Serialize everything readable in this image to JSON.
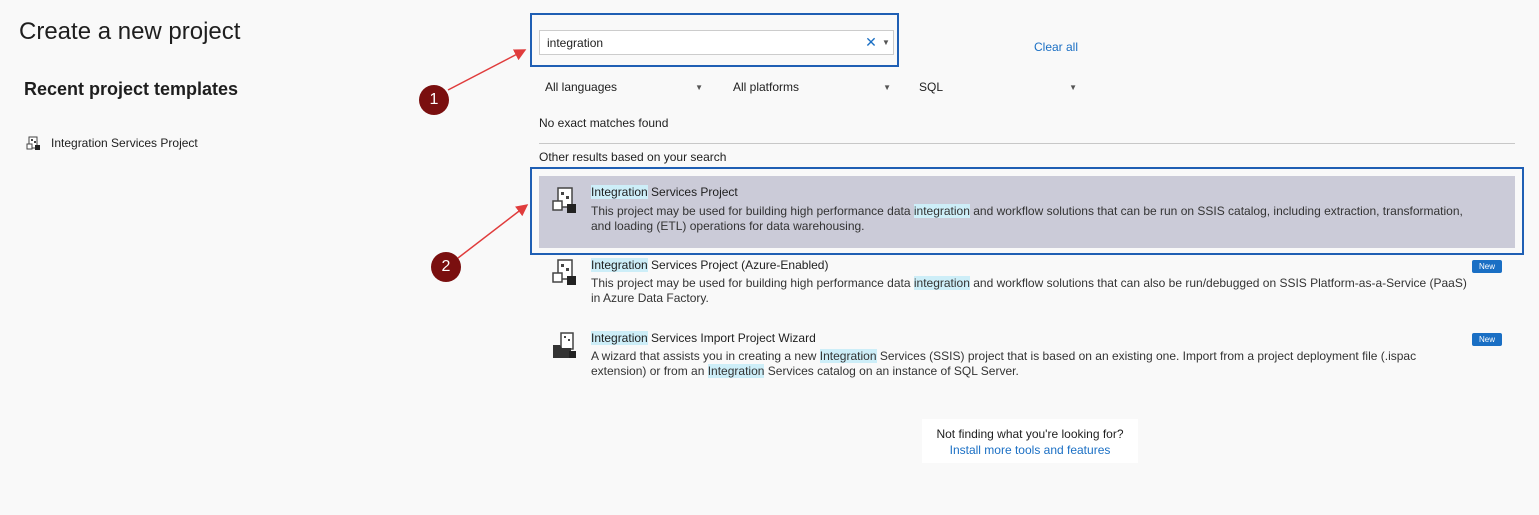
{
  "header": {
    "title": "Create a new project"
  },
  "recent": {
    "title": "Recent project templates",
    "items": [
      {
        "label": "Integration Services Project",
        "icon": "ssis-project-icon"
      }
    ]
  },
  "search": {
    "value": "integration",
    "clear_icon": "close-icon",
    "dropdown_icon": "chevron-down-icon"
  },
  "clear_all_label": "Clear all",
  "filters": {
    "language": "All languages",
    "platform": "All platforms",
    "project_type": "SQL"
  },
  "status": {
    "no_match": "No exact matches found",
    "other_results": "Other results based on your search"
  },
  "results": [
    {
      "title_hl": "Integration",
      "title_rest": " Services Project",
      "desc_a": "This project may be used for building high performance data ",
      "desc_hl": "integration",
      "desc_b": " and workflow solutions that can be run on SSIS catalog, including extraction, transformation, and loading (ETL) operations for data warehousing.",
      "selected": true
    },
    {
      "title_hl": "Integration",
      "title_rest": " Services Project (Azure-Enabled)",
      "desc_a": "This project may be used for building high performance data ",
      "desc_hl": "integration",
      "desc_b": " and workflow solutions that can also be run/debugged on SSIS Platform-as-a-Service (PaaS) in Azure Data Factory.",
      "badge": "New"
    },
    {
      "title_hl": "Integration",
      "title_rest": " Services Import Project Wizard",
      "desc_a": "A wizard that assists you in creating a new ",
      "desc_hl": "Integration",
      "desc_b": " Services (SSIS) project that is based on an existing one. Import from a project deployment file (.ispac extension) or from an ",
      "desc_hl2": "Integration",
      "desc_c": " Services catalog on an instance of SQL Server.",
      "badge": "New"
    }
  ],
  "callouts": {
    "one": "1",
    "two": "2"
  },
  "footer": {
    "question": "Not finding what you're looking for?",
    "link": "Install more tools and features"
  },
  "colors": {
    "accent": "#1a6fc4",
    "highlight_border": "#1f5fb4",
    "callout": "#7a0f0f",
    "arrow": "#e03c3c",
    "selected_bg": "#cbcbd8"
  }
}
